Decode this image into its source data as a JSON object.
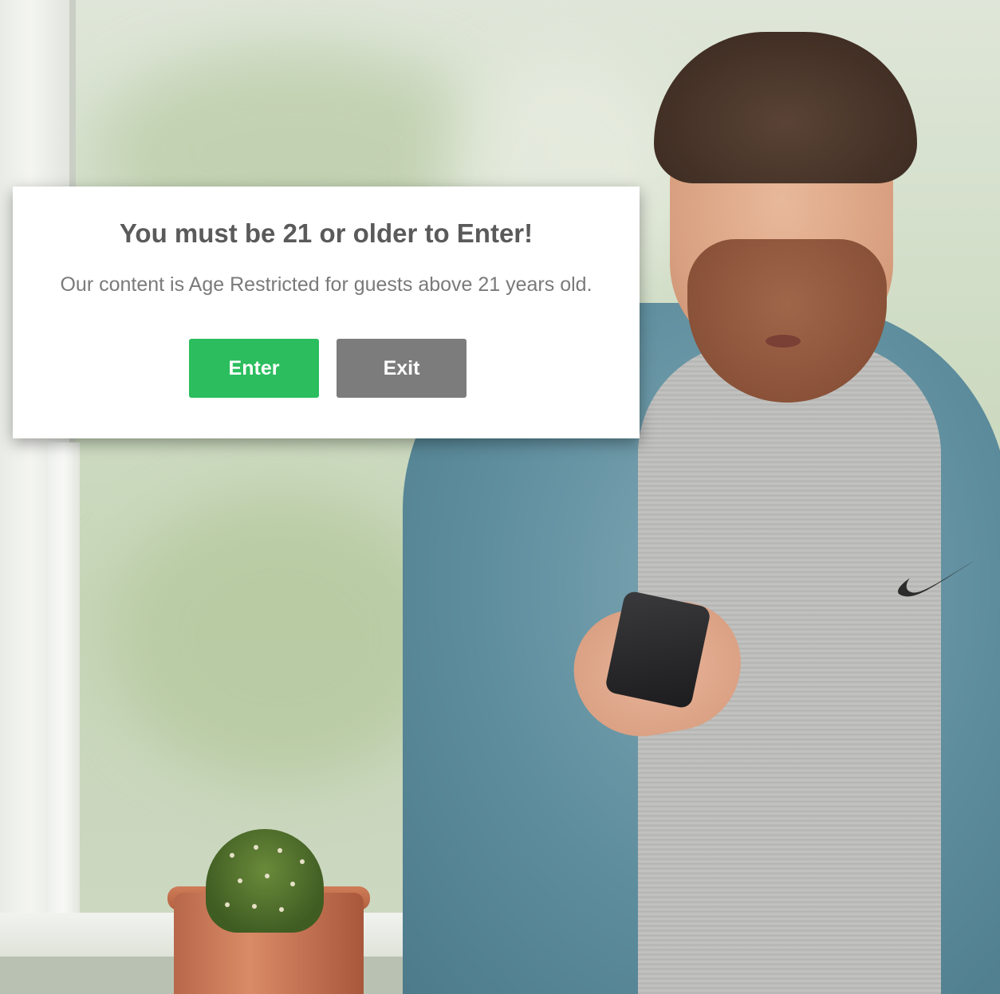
{
  "modal": {
    "title": "You must be 21 or older to Enter!",
    "message": "Our content is Age Restricted for guests above 21 years old.",
    "enter_label": "Enter",
    "exit_label": "Exit"
  },
  "colors": {
    "enter_button": "#2bbd5e",
    "exit_button": "#7c7c7c",
    "title_text": "#5a5a5a",
    "message_text": "#7a7a7a"
  },
  "background": {
    "icons": [
      "nike-swoosh-logo-icon"
    ]
  }
}
